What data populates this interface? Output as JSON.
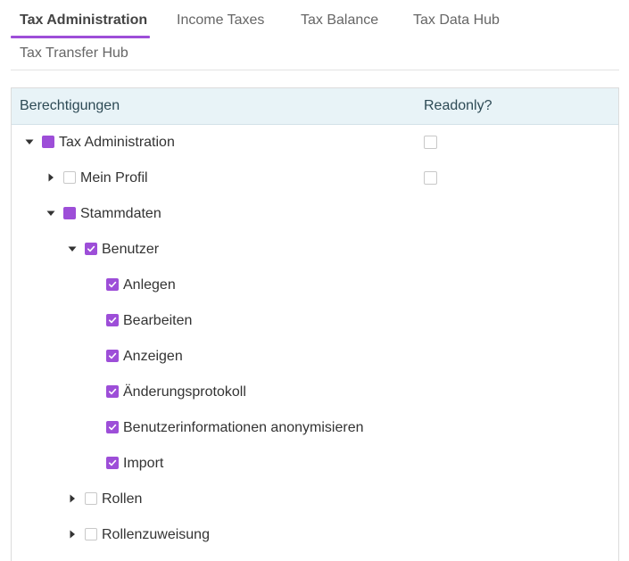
{
  "tabs": [
    {
      "label": "Tax Administration",
      "active": true
    },
    {
      "label": "Income Taxes",
      "active": false
    },
    {
      "label": "Tax Balance",
      "active": false
    },
    {
      "label": "Tax Data Hub",
      "active": false
    },
    {
      "label": "Tax Transfer Hub",
      "active": false
    }
  ],
  "tree": {
    "columns": {
      "permissions": "Berechtigungen",
      "readonly": "Readonly?"
    },
    "rows": [
      {
        "label": "Tax Administration",
        "level": 0,
        "toggle": "expanded",
        "state": "partial",
        "readonly": false
      },
      {
        "label": "Mein Profil",
        "level": 1,
        "toggle": "collapsed",
        "state": "unchecked",
        "readonly": false
      },
      {
        "label": "Stammdaten",
        "level": 1,
        "toggle": "expanded",
        "state": "partial"
      },
      {
        "label": "Benutzer",
        "level": 2,
        "toggle": "expanded",
        "state": "checked"
      },
      {
        "label": "Anlegen",
        "level": 3,
        "toggle": "none",
        "state": "checked"
      },
      {
        "label": "Bearbeiten",
        "level": 3,
        "toggle": "none",
        "state": "checked"
      },
      {
        "label": "Anzeigen",
        "level": 3,
        "toggle": "none",
        "state": "checked"
      },
      {
        "label": "Änderungsprotokoll",
        "level": 3,
        "toggle": "none",
        "state": "checked"
      },
      {
        "label": "Benutzerinformationen anonymisieren",
        "level": 3,
        "toggle": "none",
        "state": "checked"
      },
      {
        "label": "Import",
        "level": 3,
        "toggle": "none",
        "state": "checked"
      },
      {
        "label": "Rollen",
        "level": 2,
        "toggle": "collapsed",
        "state": "unchecked"
      },
      {
        "label": "Rollenzuweisung",
        "level": 2,
        "toggle": "collapsed",
        "state": "unchecked"
      }
    ]
  },
  "colors": {
    "accent": "#9d4ed8",
    "header_bg": "#e8f3f7"
  },
  "icons": {
    "expanded": "caret-down-icon",
    "collapsed": "caret-right-icon",
    "checked": "check-icon"
  }
}
